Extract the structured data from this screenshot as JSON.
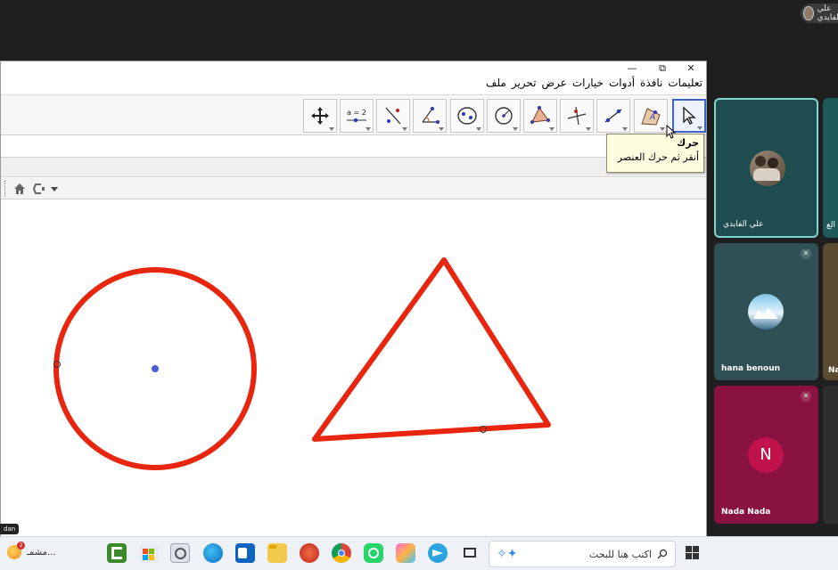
{
  "self_view": {
    "name": "علي الفايدي"
  },
  "window": {
    "controls": {
      "close": "✕",
      "restore": "⧉",
      "minimize": "—"
    },
    "menu": [
      "ملف",
      "تحرير",
      "عرض",
      "خيارات",
      "أدوات",
      "نافذة",
      "تعليمات"
    ],
    "tools": [
      {
        "id": "move",
        "icon": "cursor-arrow-icon",
        "active": true
      },
      {
        "id": "point",
        "icon": "point-on-shape-icon"
      },
      {
        "id": "line",
        "icon": "line-through-two-points-icon"
      },
      {
        "id": "perpendicular",
        "icon": "perpendicular-line-icon"
      },
      {
        "id": "polygon",
        "icon": "polygon-icon"
      },
      {
        "id": "circle",
        "icon": "circle-center-point-icon"
      },
      {
        "id": "ellipse",
        "icon": "ellipse-icon"
      },
      {
        "id": "angle",
        "icon": "angle-icon"
      },
      {
        "id": "reflect",
        "icon": "reflect-about-line-icon"
      },
      {
        "id": "slider",
        "icon": "slider-icon",
        "label": "a = 2"
      },
      {
        "id": "move-graphics",
        "icon": "move-graphics-view-icon"
      }
    ],
    "tooltip": {
      "title": "حرك",
      "body": "أنقر ثم حرك العنصر"
    }
  },
  "colors": {
    "shape_stroke": "#e8260f",
    "center_point": "#4b5bd6",
    "active_tool_border": "#3b63c8",
    "tooltip_bg": "#fffde0"
  },
  "participants": [
    {
      "name": "علي الفايدي",
      "kind": "photo",
      "bg": "#1f4d4f",
      "highlight": true
    },
    {
      "name": "hana benoun",
      "kind": "photo",
      "bg": "#2f5155",
      "muted": true
    },
    {
      "name": "Nada Nada",
      "kind": "letter",
      "letter": "N",
      "bg": "#8a1240",
      "muted": true
    }
  ],
  "partial_tiles": {
    "top": {
      "name_fragment": "الع",
      "bg": "#1f5a58"
    },
    "middle": {
      "name_fragment": "Na",
      "bg": "#5a4a30"
    },
    "bottom": {
      "bg": "#2e2e2e"
    }
  },
  "taskbar": {
    "search_placeholder": "اكتب هنا للبحث",
    "weather_label": "مشمـ...",
    "weather_badge": "2",
    "chip_text": "dan"
  }
}
